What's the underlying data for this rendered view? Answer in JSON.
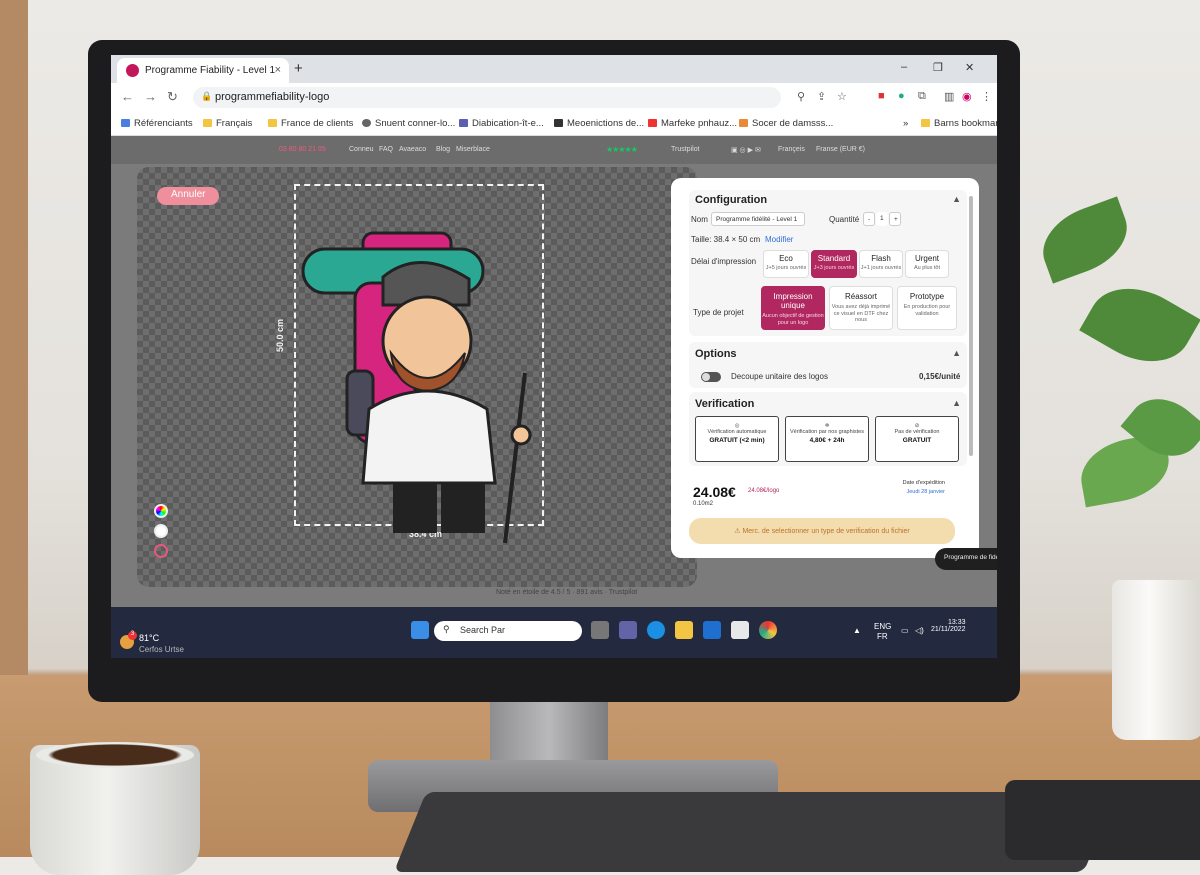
{
  "browser": {
    "tab_title": "Programme Fiability - Level 1",
    "tab_close": "×",
    "new_tab": "+",
    "url": "programmefiability-logo",
    "window_controls": [
      "–",
      "❐",
      "✕"
    ]
  },
  "bookmarks": {
    "items": [
      "Référenciants",
      "Français",
      "France de clients",
      "Snuent conner-lo...",
      "Diabication-ît-e...",
      "Meoenictions de...",
      "Marfeke pnhauz...",
      "Socer de damsss..."
    ],
    "more": "»",
    "all_bookmarks": "Barns bookmarks"
  },
  "site_header": {
    "phone": "03 80 80 21 05",
    "nav": [
      "Conneu",
      "FAQ",
      "Avaeaco",
      "Blog",
      "Miserblace"
    ],
    "trustpilot_stars": "★★★★★",
    "trustpilot_label": "Trustpilot",
    "lang": "Françeis",
    "currency": "Franse (EUR €)"
  },
  "editor": {
    "cancel_label": "Annuler",
    "width_label": "38.4 cm",
    "height_label": "50.0 cm"
  },
  "config": {
    "title": "Configuration",
    "name_label": "Nom",
    "name_value": "Programme fidélité - Level 1",
    "qty_label": "Quantité",
    "qty_minus": "-",
    "qty_value": "1",
    "qty_plus": "+",
    "size_text": "Taille: 38.4 × 50 cm",
    "modify_label": "Modifier",
    "delay_label": "Délai d'impression",
    "delays": [
      {
        "name": "Eco",
        "sub": "J+5 jours ouvrés"
      },
      {
        "name": "Standard",
        "sub": "J+3 jours ouvrés"
      },
      {
        "name": "Flash",
        "sub": "J+1 jours ouvrés"
      },
      {
        "name": "Urgent",
        "sub": "Au plus tôt"
      }
    ],
    "project_label": "Type de projet",
    "projects": [
      {
        "name": "Impression unique",
        "sub": "Aucun objectif de gestion pour un logo"
      },
      {
        "name": "Réassort",
        "sub": "Vous avez déjà imprimé ce visuel en DTF chez nous"
      },
      {
        "name": "Prototype",
        "sub": "En production pour validation"
      }
    ]
  },
  "options": {
    "title": "Options",
    "decoupe_label": "Decoupe unitaire des logos",
    "decoupe_price": "0,15€/unité"
  },
  "verification": {
    "title": "Verification",
    "cards": [
      {
        "desc": "Vérification automatique",
        "value": "GRATUIT (<2 min)"
      },
      {
        "desc": "Vérification par nos graphistes",
        "value": "4,80€ + 24h"
      },
      {
        "desc": "Pas de vérification",
        "value": "GRATUIT"
      }
    ]
  },
  "summary": {
    "price": "24.08€",
    "unit_price": "24.08€/logo",
    "surface": "0.10m2",
    "shipping_label": "Date d'expédition",
    "shipping_date": "Jeudi 28 janvier",
    "warning": "Merc. de selectionner un type de verification du fichier"
  },
  "chat": {
    "label": "Programme de fidélité"
  },
  "footer": {
    "rating": "Noté en étoile de 4.5 / 5 · 891 avis · Trustpilot"
  },
  "taskbar": {
    "temp": "81°C",
    "weather": "Cerfos Urtse",
    "weather_badge": "3",
    "search_placeholder": "Search Par",
    "lang": "ENG",
    "lang_sub": "FR",
    "time": "13:33",
    "date": "21/11/2022"
  }
}
